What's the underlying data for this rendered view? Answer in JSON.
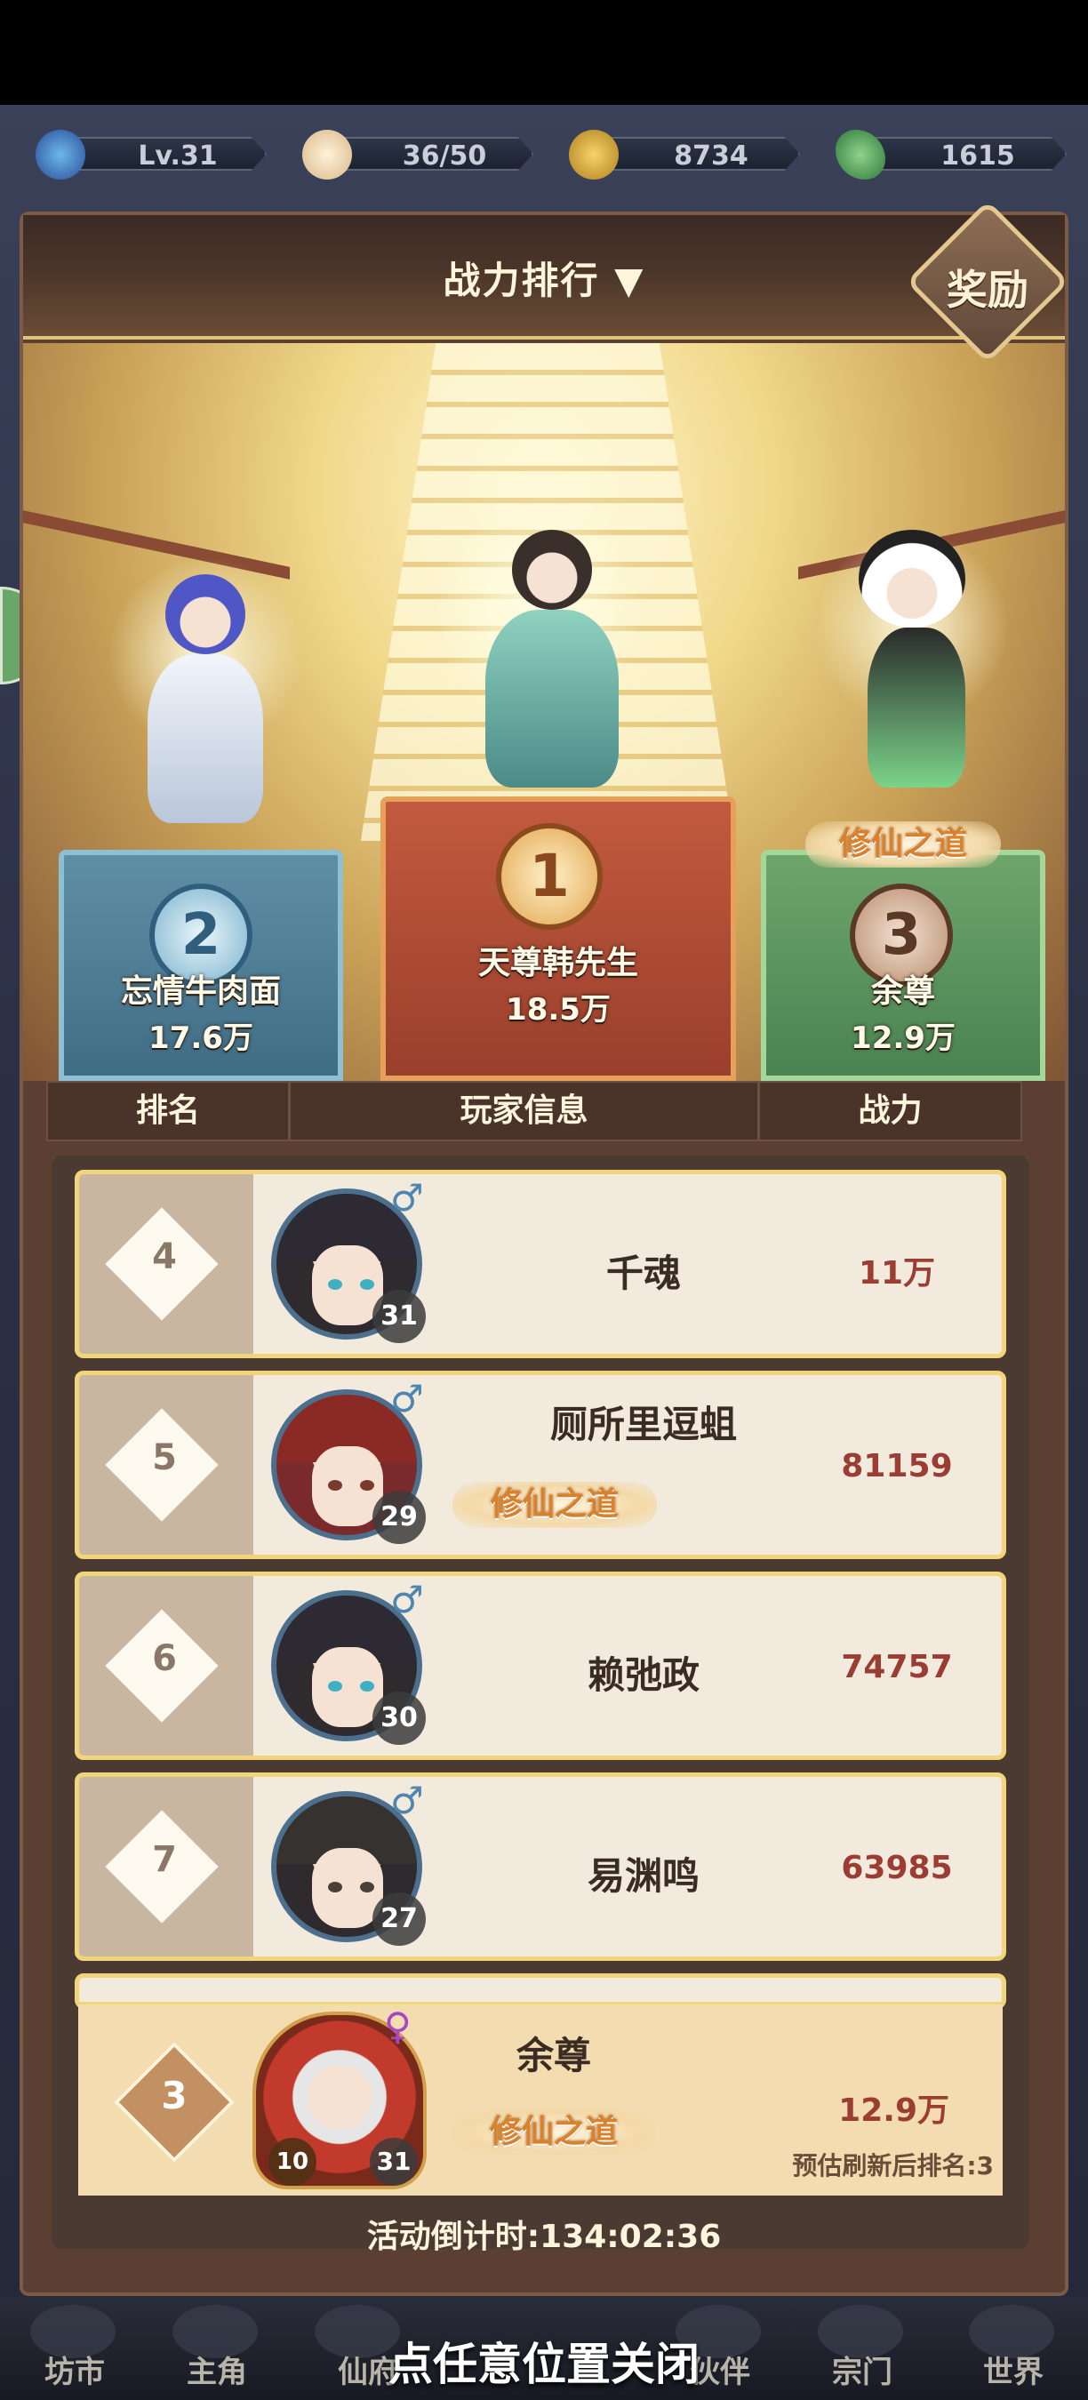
{
  "resources": [
    {
      "icon": "dragon-level-icon",
      "value": "Lv.31"
    },
    {
      "icon": "steamed-bun-icon",
      "value": "36/50"
    },
    {
      "icon": "copper-coin-icon",
      "value": "8734"
    },
    {
      "icon": "jade-leaf-icon",
      "value": "1615"
    }
  ],
  "header": {
    "title": "战力排行 ▼",
    "reward_label": "奖励"
  },
  "podium": {
    "first": {
      "rank": "1",
      "name": "天尊韩先生",
      "power": "18.5万"
    },
    "second": {
      "rank": "2",
      "name": "忘情牛肉面",
      "power": "17.6万"
    },
    "third": {
      "rank": "3",
      "name": "余尊",
      "power": "12.9万",
      "badge": "修仙之道"
    }
  },
  "table": {
    "headers": [
      "排名",
      "玩家信息",
      "战力"
    ],
    "rows": [
      {
        "rank": "4",
        "level": "31",
        "gender": "♂",
        "name": "千魂",
        "power": "11万"
      },
      {
        "rank": "5",
        "level": "29",
        "gender": "♂",
        "name": "厕所里逗蛆",
        "badge": "修仙之道",
        "power": "81159"
      },
      {
        "rank": "6",
        "level": "30",
        "gender": "♂",
        "name": "赖弛政",
        "power": "74757"
      },
      {
        "rank": "7",
        "level": "27",
        "gender": "♂",
        "name": "易渊鸣",
        "power": "63985"
      }
    ]
  },
  "self": {
    "rank": "3",
    "vip": "10",
    "level": "31",
    "gender": "♀",
    "name": "余尊",
    "badge": "修仙之道",
    "power": "12.9万",
    "estimate": "预估刷新后排名:3"
  },
  "countdown": "活动倒计时:134:02:36",
  "close_hint": "点任意位置关闭",
  "nav": [
    "坊市",
    "主角",
    "仙府",
    "伙伴",
    "宗门",
    "世界"
  ]
}
